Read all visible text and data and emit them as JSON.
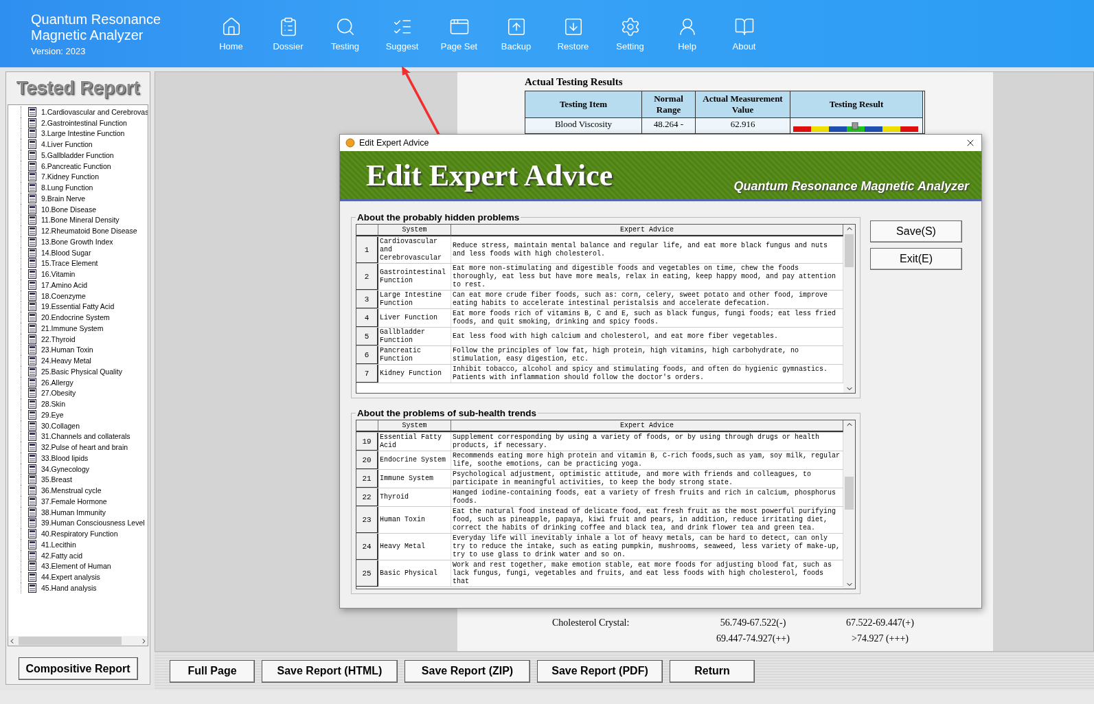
{
  "app": {
    "title_lines": [
      "Quantum Resonance",
      "Magnetic Analyzer"
    ],
    "version": "Version: 2023"
  },
  "toolbar": [
    {
      "label": "Home",
      "kind": "home"
    },
    {
      "label": "Dossier",
      "kind": "dossier"
    },
    {
      "label": "Testing",
      "kind": "testing"
    },
    {
      "label": "Suggest",
      "kind": "suggest"
    },
    {
      "label": "Page Set",
      "kind": "pageset"
    },
    {
      "label": "Backup",
      "kind": "backup"
    },
    {
      "label": "Restore",
      "kind": "restore"
    },
    {
      "label": "Setting",
      "kind": "setting"
    },
    {
      "label": "Help",
      "kind": "help"
    },
    {
      "label": "About",
      "kind": "about"
    }
  ],
  "sidebar": {
    "title": "Tested Report",
    "items": [
      "1.Cardiovascular and Cerebrovas",
      "2.Gastrointestinal Function",
      "3.Large Intestine Function",
      "4.Liver Function",
      "5.Gallbladder Function",
      "6.Pancreatic Function",
      "7.Kidney Function",
      "8.Lung Function",
      "9.Brain Nerve",
      "10.Bone Disease",
      "11.Bone Mineral Density",
      "12.Rheumatoid Bone Disease",
      "13.Bone Growth Index",
      "14.Blood Sugar",
      "15.Trace Element",
      "16.Vitamin",
      "17.Amino Acid",
      "18.Coenzyme",
      "19.Essential Fatty Acid",
      "20.Endocrine System",
      "21.Immune System",
      "22.Thyroid",
      "23.Human Toxin",
      "24.Heavy Metal",
      "25.Basic Physical Quality",
      "26.Allergy",
      "27.Obesity",
      "28.Skin",
      "29.Eye",
      "30.Collagen",
      "31.Channels and collaterals",
      "32.Pulse of heart and brain",
      "33.Blood lipids",
      "34.Gynecology",
      "35.Breast",
      "36.Menstrual cycle",
      "37.Female Hormone",
      "38.Human Immunity",
      "39.Human Consciousness Level",
      "40.Respiratory Function",
      "41.Lecithin",
      "42.Fatty acid",
      "43.Element of Human",
      "44.Expert analysis",
      "45.Hand analysis"
    ],
    "button": "Compositive Report"
  },
  "report": {
    "heading": "Actual Testing Results",
    "columns": [
      "Testing Item",
      "Normal Range",
      "Actual Measurement Value",
      "Testing Result"
    ],
    "row": [
      "Blood Viscosity",
      "48.264 -",
      "62.916"
    ],
    "cholesterol": {
      "label": "Cholesterol Crystal:",
      "ranges": [
        "56.749-67.522(-)",
        "67.522-69.447(+)",
        "69.447-74.927(++)",
        ">74.927 (+++)"
      ]
    }
  },
  "dialog": {
    "title": "Edit Expert Advice",
    "banner_title": "Edit Expert Advice",
    "banner_subtitle": "Quantum Resonance Magnetic Analyzer",
    "buttons": [
      "Save(S)",
      "Exit(E)"
    ],
    "groups": [
      {
        "title": "About the probably hidden problems",
        "columns": [
          "System",
          "Expert Advice"
        ],
        "rows": [
          {
            "no": "1",
            "system": "Cardiovascular and Cerebrovascular",
            "advice": "Reduce stress, maintain mental balance and regular life, and eat more black fungus and nuts and less foods with high cholesterol."
          },
          {
            "no": "2",
            "system": "Gastrointestinal Function",
            "advice": "Eat more non-stimulating and digestible foods and vegetables on time, chew the foods thoroughly, eat less but have more meals, relax in eating, keep happy mood, and pay attention to rest."
          },
          {
            "no": "3",
            "system": "Large Intestine Function",
            "advice": "Can eat more crude fiber foods, such as: corn, celery, sweet potato and other food, improve eating habits to accelerate intestinal peristalsis and accelerate defecation."
          },
          {
            "no": "4",
            "system": "Liver Function",
            "advice": "Eat more foods rich of vitamins B, C and E, such as black fungus, fungi foods; eat less fried foods, and quit smoking, drinking and spicy foods."
          },
          {
            "no": "5",
            "system": "Gallbladder Function",
            "advice": "Eat less food with high calcium and cholesterol, and eat more fiber vegetables."
          },
          {
            "no": "6",
            "system": "Pancreatic Function",
            "advice": "Follow the principles of low fat, high protein, high vitamins, high carbohydrate, no stimulation, easy digestion, etc."
          },
          {
            "no": "7",
            "system": "Kidney Function",
            "advice": "Inhibit tobacco, alcohol and spicy and stimulating foods, and often do hygienic gymnastics. Patients with inflammation should follow the doctor's orders."
          }
        ]
      },
      {
        "title": "About the problems of sub-health trends",
        "columns": [
          "System",
          "Expert Advice"
        ],
        "rows": [
          {
            "no": "19",
            "system": "Essential Fatty Acid",
            "advice": "Supplement corresponding by using a variety of foods, or by using through drugs or health products, if necessary."
          },
          {
            "no": "20",
            "system": "Endocrine System",
            "advice": "Recommends eating more high protein and vitamin B, C-rich foods,such as yam, soy milk, regular life, soothe emotions, can be practicing yoga."
          },
          {
            "no": "21",
            "system": "Immune System",
            "advice": "Psychological adjustment, optimistic attitude, and more with friends and colleagues, to participate in meaningful activities, to keep the body strong state."
          },
          {
            "no": "22",
            "system": "Thyroid",
            "advice": "Hanged iodine-containing foods, eat a variety of fresh fruits and rich in calcium, phosphorus foods."
          },
          {
            "no": "23",
            "system": "Human Toxin",
            "advice": "Eat the natural food instead of delicate food, eat fresh fruit as the most powerful purifying food, such as pineapple, papaya, kiwi fruit and pears, in addition, reduce irritating diet, correct the habits of drinking coffee and black tea, and drink flower tea and green tea."
          },
          {
            "no": "24",
            "system": "Heavy Metal",
            "advice": "Everyday life will inevitably inhale a lot of heavy metals, can be hard to detect, can only try to reduce the intake, such as eating pumpkin, mushrooms, seaweed, less variety of make-up, try to use glass to drink water and so on."
          },
          {
            "no": "25",
            "system": "Basic Physical",
            "advice": "Work and rest together, make emotion stable, eat more foods for adjusting blood fat, such as lack fungus, fungi, vegetables and fruits, and eat less foods with high cholesterol, foods that"
          }
        ]
      }
    ]
  },
  "bottom_buttons": [
    "Full Page",
    "Save Report (HTML)",
    "Save Report (ZIP)",
    "Save Report (PDF)",
    "Return"
  ]
}
